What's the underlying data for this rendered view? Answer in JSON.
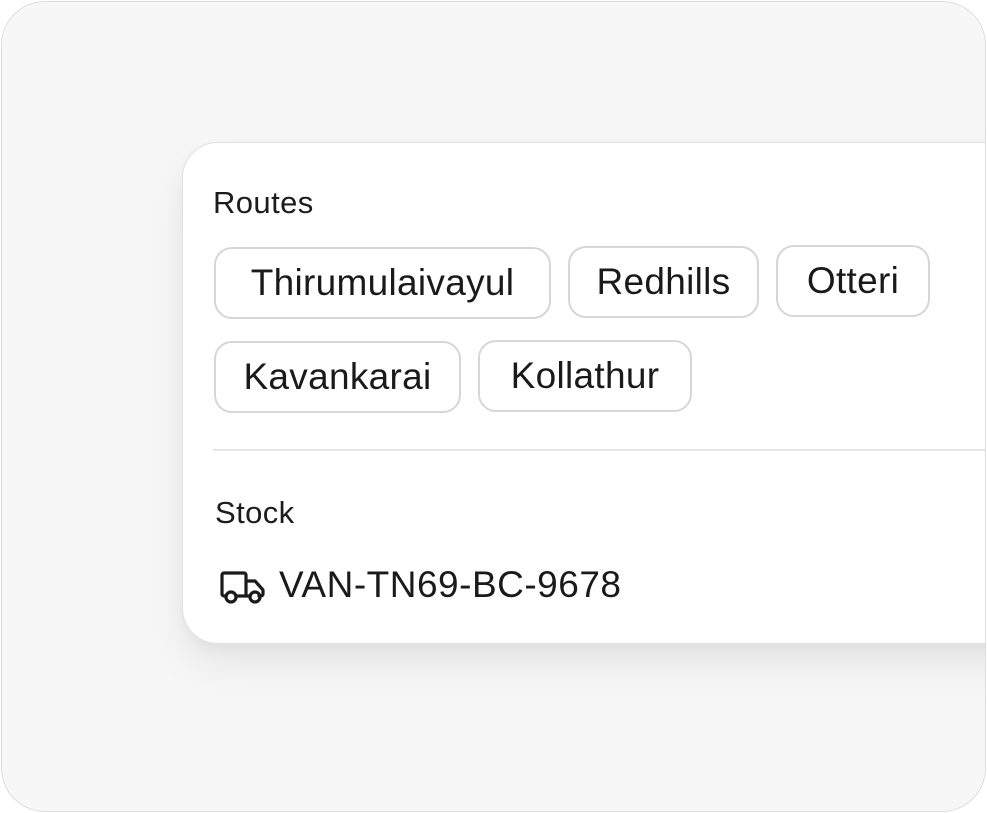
{
  "routes": {
    "heading": "Routes",
    "chips": [
      {
        "label": "Thirumulaivayul"
      },
      {
        "label": "Redhills"
      },
      {
        "label": "Otteri"
      },
      {
        "label": "Kavankarai"
      },
      {
        "label": "Kollathur"
      }
    ]
  },
  "stock": {
    "heading": "Stock",
    "vehicle_icon": "truck-icon",
    "vehicle_id": "VAN-TN69-BC-9678"
  },
  "colors": {
    "frame_background": "#f7f7f7",
    "card_background": "#ffffff",
    "chip_border": "#d6d6d6",
    "text": "#1a1a1a"
  }
}
